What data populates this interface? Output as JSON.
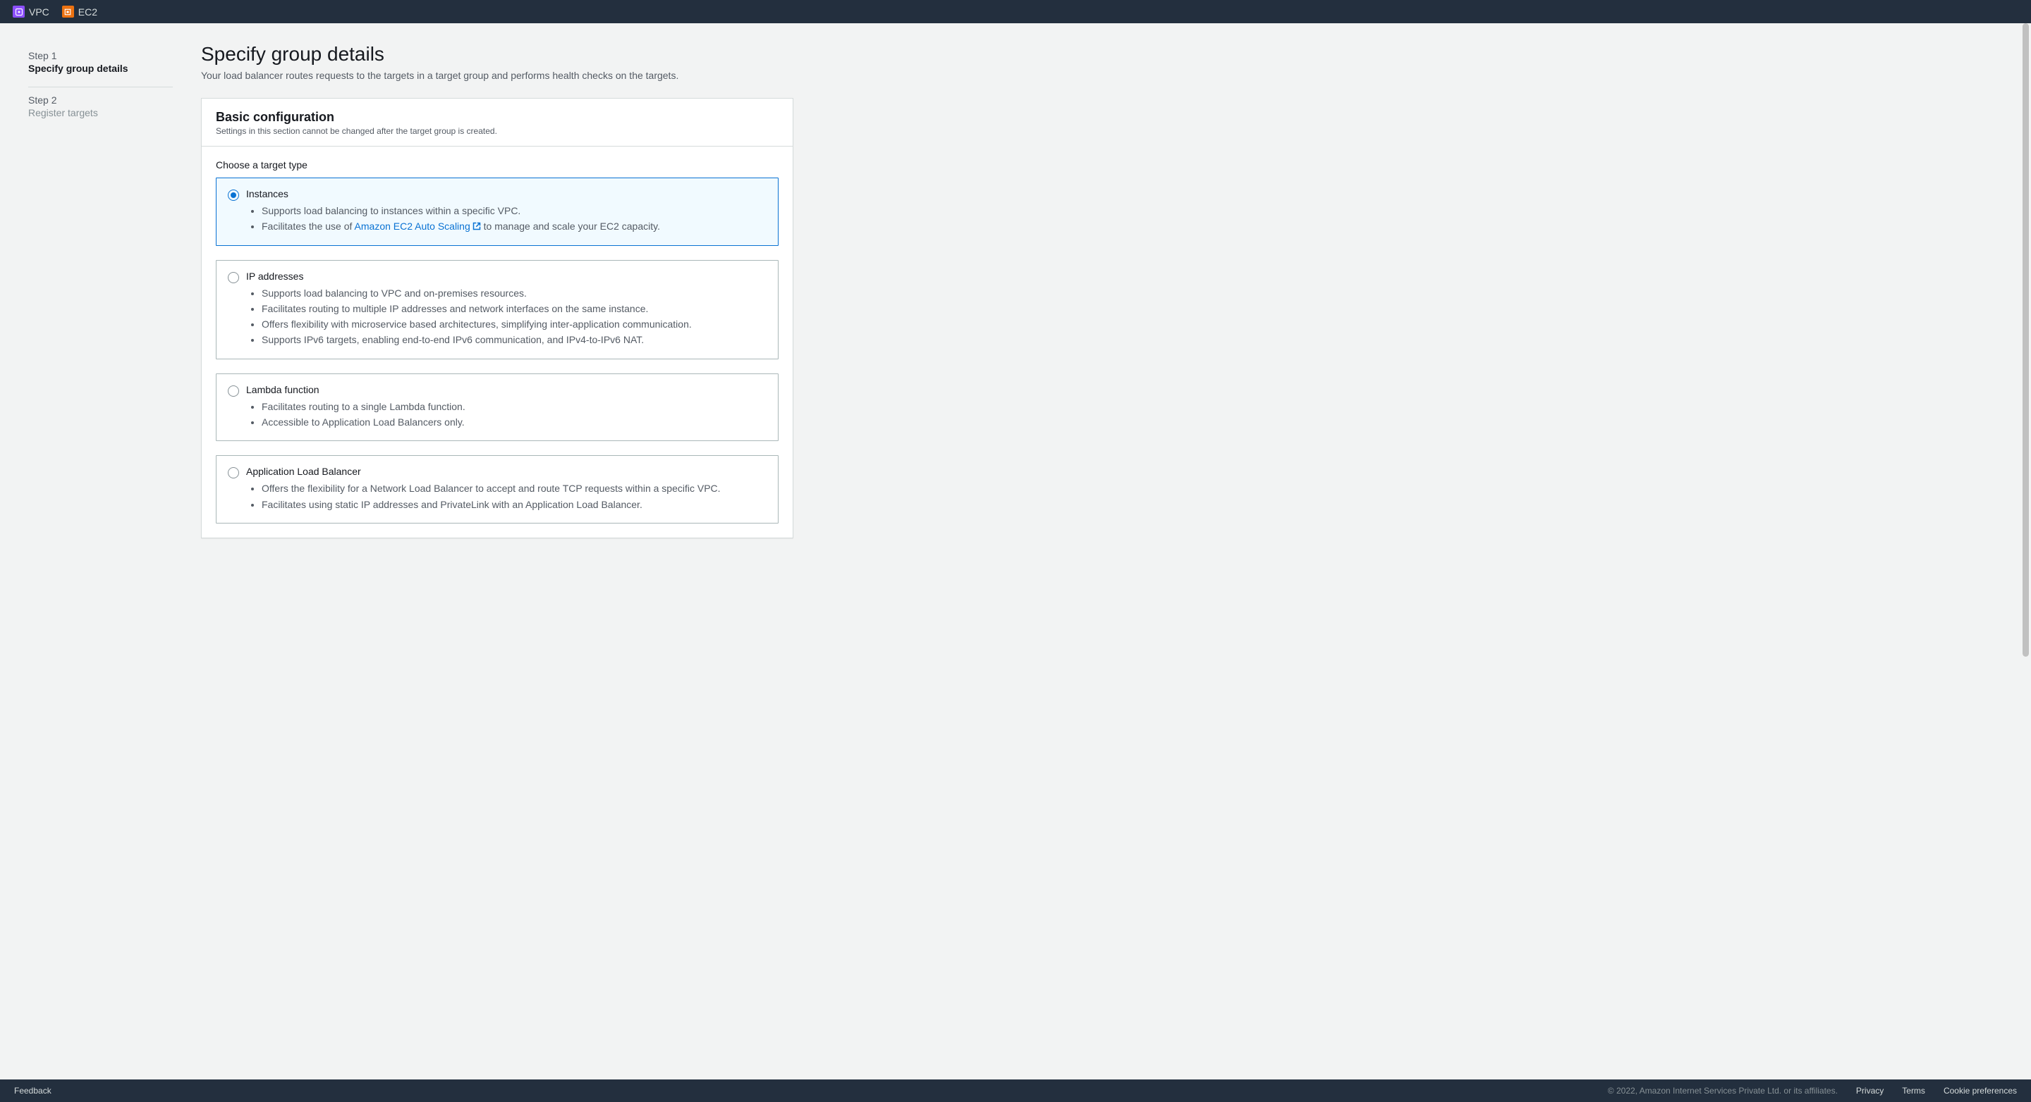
{
  "nav": {
    "items": [
      {
        "label": "VPC"
      },
      {
        "label": "EC2"
      }
    ]
  },
  "sidebar": {
    "steps": [
      {
        "label": "Step 1",
        "title": "Specify group details"
      },
      {
        "label": "Step 2",
        "title": "Register targets"
      }
    ]
  },
  "page": {
    "title": "Specify group details",
    "subtitle": "Your load balancer routes requests to the targets in a target group and performs health checks on the targets."
  },
  "basic_config": {
    "title": "Basic configuration",
    "subtitle": "Settings in this section cannot be changed after the target group is created.",
    "target_type_label": "Choose a target type",
    "options": {
      "instances": {
        "title": "Instances",
        "bullet1": "Supports load balancing to instances within a specific VPC.",
        "bullet2_prefix": "Facilitates the use of ",
        "bullet2_link": "Amazon EC2 Auto Scaling",
        "bullet2_suffix": " to manage and scale your EC2 capacity."
      },
      "ip": {
        "title": "IP addresses",
        "bullet1": "Supports load balancing to VPC and on-premises resources.",
        "bullet2": "Facilitates routing to multiple IP addresses and network interfaces on the same instance.",
        "bullet3": "Offers flexibility with microservice based architectures, simplifying inter-application communication.",
        "bullet4": "Supports IPv6 targets, enabling end-to-end IPv6 communication, and IPv4-to-IPv6 NAT."
      },
      "lambda": {
        "title": "Lambda function",
        "bullet1": "Facilitates routing to a single Lambda function.",
        "bullet2": "Accessible to Application Load Balancers only."
      },
      "alb": {
        "title": "Application Load Balancer",
        "bullet1": "Offers the flexibility for a Network Load Balancer to accept and route TCP requests within a specific VPC.",
        "bullet2": "Facilitates using static IP addresses and PrivateLink with an Application Load Balancer."
      }
    }
  },
  "footer": {
    "feedback": "Feedback",
    "copyright": "© 2022, Amazon Internet Services Private Ltd. or its affiliates.",
    "privacy": "Privacy",
    "terms": "Terms",
    "cookies": "Cookie preferences"
  }
}
